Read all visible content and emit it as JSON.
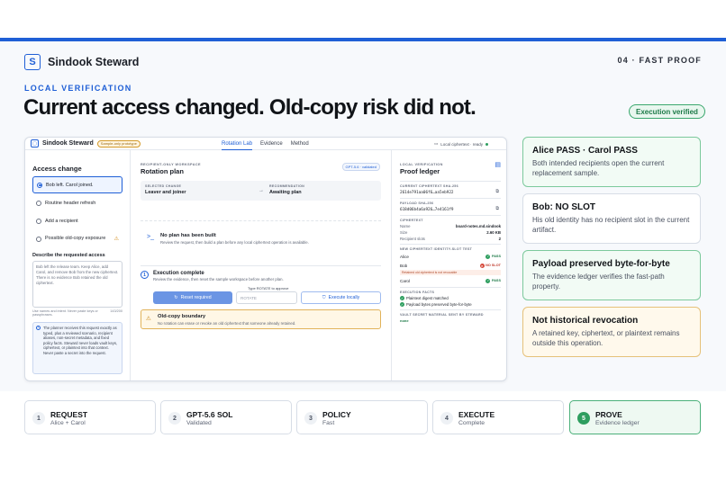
{
  "brand": {
    "logo_letter": "S",
    "name": "Sindook Steward",
    "slide": "04 · FAST PROOF"
  },
  "eyebrow": "LOCAL VERIFICATION",
  "headline": "Current access changed. Old-copy risk did not.",
  "verified_pill": "Execution verified",
  "app": {
    "title": "Sindook Steward",
    "proto_pill": "Sample-only prototype",
    "tabs": [
      {
        "label": "Rotation Lab",
        "active": true
      },
      {
        "label": "Evidence"
      },
      {
        "label": "Method"
      }
    ],
    "status": "Local ciphertext · ready",
    "left": {
      "heading": "Access change",
      "options": [
        {
          "label": "Bob left. Carol joined.",
          "selected": true
        },
        {
          "label": "Routine header refresh"
        },
        {
          "label": "Add a recipient"
        },
        {
          "label": "Possible old-copy exposure",
          "warn": true
        }
      ],
      "request_heading": "Describe the requested access",
      "request_text": "Bob left the release team. Keep Alice, add Carol, and remove Bob from the new ciphertext. There is no evidence Bob retained the old ciphertext.",
      "hint_left": "Use names and intent. Never paste keys or passphrases.",
      "hint_right": "143/200",
      "info_text": "The planner receives this request exactly as typed, plus a reviewed scenario, recipient aliases, non-secret metadata, and fixed policy facts. Steward never loads vault keys, ciphertext, or plaintext into that context. Never paste a secret into the request."
    },
    "mid": {
      "eyebrow": "RECIPIENT-ONLY WORKSPACE",
      "heading": "Rotation plan",
      "model_pill": "GPT-5.6 · validated",
      "selected_label": "SELECTED CHANGE",
      "selected_value": "Leaver and joiner",
      "rec_label": "RECOMMENDATION",
      "rec_value": "Awaiting plan",
      "no_plan_title": "No plan has been built",
      "no_plan_sub": "Review the request, then build a plan before any local ciphertext operation is available.",
      "step_number": "1",
      "exec_title": "Execution complete",
      "exec_sub": "Review the evidence, then reset the sample workspace before another plan.",
      "type_label": "Type ROTATE to approve",
      "reset_label": "Reset required",
      "rotate_placeholder": "ROTATE",
      "exec_label": "Execute locally",
      "risk_title": "Old-copy boundary",
      "risk_sub": "No rotation can erase or revoke an old ciphertext that someone already retained."
    },
    "right": {
      "eyebrow": "LOCAL VERIFICATION",
      "heading": "Proof ledger",
      "current_label": "CURRENT CIPHERTEXT SHA-256",
      "current_hash": "2614e791aa06f6…aa5eb922",
      "payload_label": "PAYLOAD SHA-256",
      "payload_hash": "618d06b4a6a926…7e4161f9",
      "ciphertext_label": "CIPHERTEXT",
      "kv": [
        {
          "k": "Name",
          "v": "board-notes.md.sindook"
        },
        {
          "k": "Size",
          "v": "2.60 KB"
        },
        {
          "k": "Recipient slots",
          "v": "2"
        }
      ],
      "slot_label": "NEW CIPHERTEXT IDENTITY-SLOT TEST",
      "slots": [
        {
          "name": "Alice",
          "result": "PASS",
          "ok": true
        },
        {
          "name": "Bob",
          "result": "NO SLOT",
          "ok": false
        },
        {
          "name": "Carol",
          "result": "PASS",
          "ok": true
        }
      ],
      "retained_note": "Retained old ciphertext is not revocable",
      "facts_label": "EXECUTION FACTS",
      "facts": [
        "Plaintext digest matched",
        "Payload bytes preserved byte-for-byte"
      ],
      "vault_label": "VAULT SECRET MATERIAL SENT BY STEWARD",
      "vault_value": "none"
    }
  },
  "cards": [
    {
      "title": "Alice PASS · Carol PASS",
      "sub": "Both intended recipients open the current replacement sample.",
      "style": "green"
    },
    {
      "title": "Bob: NO SLOT",
      "sub": "His old identity has no recipient slot in the current artifact.",
      "style": "plain"
    },
    {
      "title": "Payload preserved byte-for-byte",
      "sub": "The evidence ledger verifies the fast-path property.",
      "style": "green"
    },
    {
      "title": "Not historical revocation",
      "sub": "A retained key, ciphertext, or plaintext remains outside this operation.",
      "style": "amber"
    }
  ],
  "steps": [
    {
      "num": "1",
      "title": "REQUEST",
      "sub": "Alice + Carol"
    },
    {
      "num": "2",
      "title": "GPT-5.6 SOL",
      "sub": "Validated"
    },
    {
      "num": "3",
      "title": "POLICY",
      "sub": "Fast"
    },
    {
      "num": "4",
      "title": "EXECUTE",
      "sub": "Complete"
    },
    {
      "num": "5",
      "title": "PROVE",
      "sub": "Evidence ledger",
      "active": true
    }
  ],
  "colors": {
    "accent": "#1f5fd6",
    "success": "#2e9e5f",
    "warning": "#d38b16",
    "danger": "#d64b3c"
  }
}
